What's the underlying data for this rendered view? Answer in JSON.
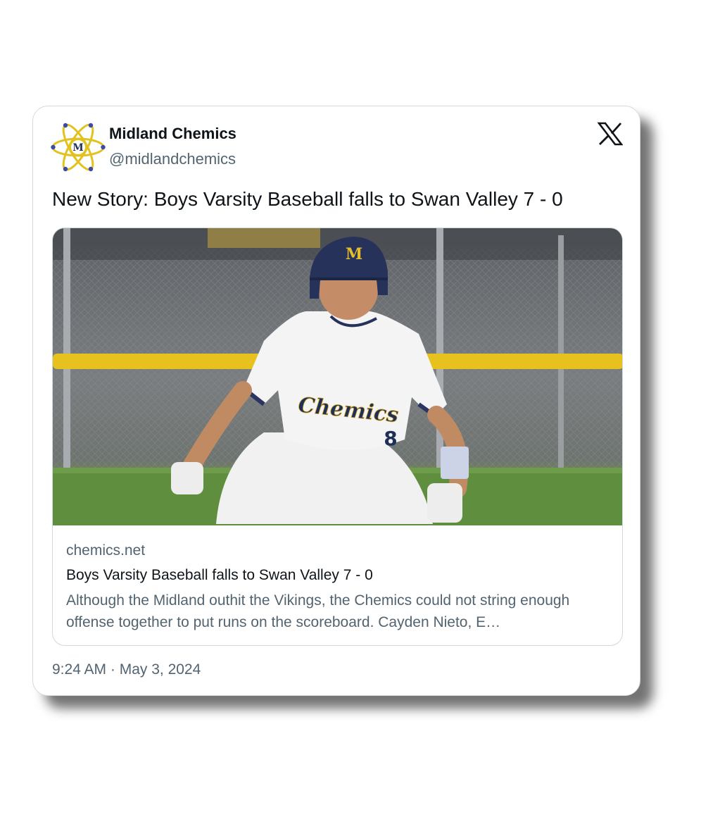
{
  "tweet": {
    "author_name": "Midland Chemics",
    "author_handle": "@midlandchemics",
    "avatar_letter": "M",
    "text": "New Story: Boys Varsity Baseball falls to Swan Valley 7 - 0",
    "timestamp": "9:24 AM · May 3, 2024"
  },
  "link_card": {
    "domain": "chemics.net",
    "title": "Boys Varsity Baseball falls to Swan Valley 7 - 0",
    "description": "Although the Midland outhit the Vikings, the Chemics could not string enough offense together to put runs on the scoreboard.  Cayden Nieto, E…",
    "image": {
      "jersey_text": "Chemics",
      "jersey_number": "8",
      "helmet_letter": "M"
    }
  },
  "icons": {
    "avatar": "atom-logo-icon",
    "platform": "x-logo-icon"
  },
  "colors": {
    "text_primary": "#0f1419",
    "text_secondary": "#536471",
    "border": "#cfd9de",
    "brand_gold": "#e8c31c",
    "brand_navy": "#1f2f57"
  }
}
